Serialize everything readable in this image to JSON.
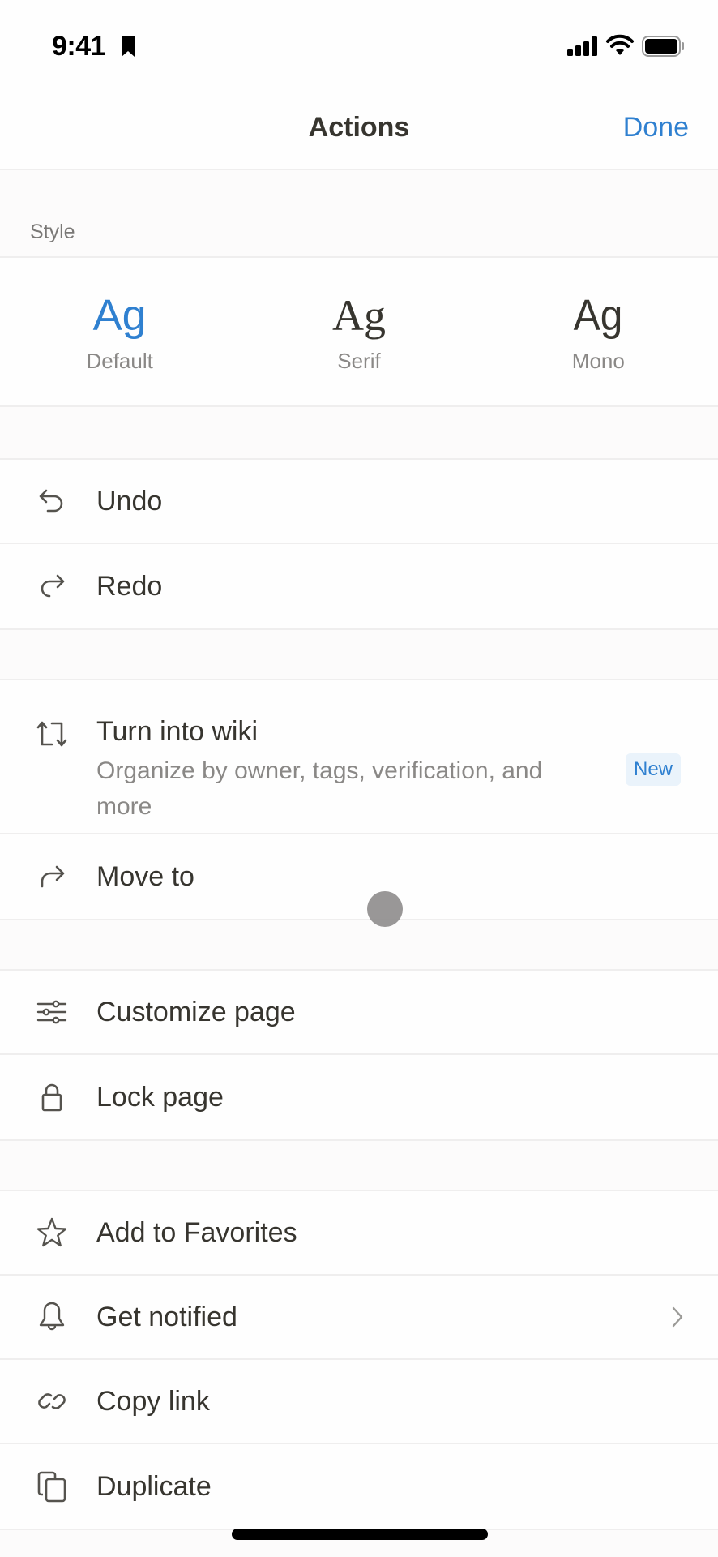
{
  "status_bar": {
    "time": "9:41",
    "icons": [
      "bookmark-icon",
      "cellular-signal-icon",
      "wifi-icon",
      "battery-icon"
    ]
  },
  "header": {
    "title": "Actions",
    "done_label": "Done"
  },
  "style_section": {
    "label": "Style",
    "options": [
      {
        "sample": "Ag",
        "label": "Default",
        "selected": true
      },
      {
        "sample": "Ag",
        "label": "Serif",
        "selected": false
      },
      {
        "sample": "Ag",
        "label": "Mono",
        "selected": false
      }
    ]
  },
  "groups": [
    {
      "items": [
        {
          "icon": "undo-icon",
          "label": "Undo"
        },
        {
          "icon": "redo-icon",
          "label": "Redo"
        }
      ]
    },
    {
      "items": [
        {
          "icon": "turn-into-wiki-icon",
          "label": "Turn into wiki",
          "subtitle": "Organize by owner, tags, verification, and more",
          "badge": "New"
        },
        {
          "icon": "move-to-icon",
          "label": "Move to"
        }
      ]
    },
    {
      "items": [
        {
          "icon": "customize-sliders-icon",
          "label": "Customize page"
        },
        {
          "icon": "lock-icon",
          "label": "Lock page"
        }
      ]
    },
    {
      "items": [
        {
          "icon": "star-icon",
          "label": "Add to Favorites"
        },
        {
          "icon": "bell-icon",
          "label": "Get notified",
          "has_chevron": true
        },
        {
          "icon": "link-icon",
          "label": "Copy link"
        },
        {
          "icon": "duplicate-icon",
          "label": "Duplicate"
        }
      ]
    }
  ],
  "colors": {
    "accent": "#2f80d0",
    "text": "#37352f",
    "secondary_text": "#8a8886",
    "badge_bg": "#eaf3fb",
    "background": "#fcfbfb"
  }
}
